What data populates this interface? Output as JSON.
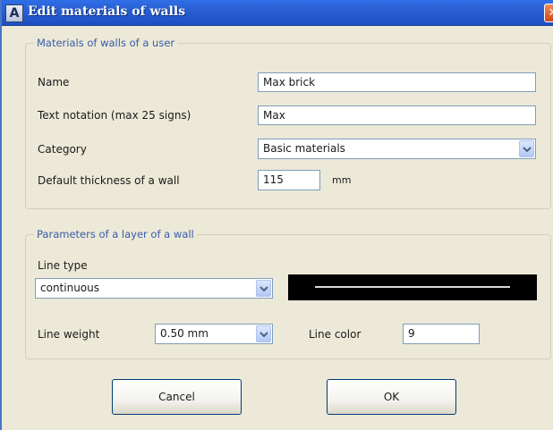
{
  "window": {
    "title": "Edit materials of walls",
    "app_icon": "A",
    "close_glyph": "✕"
  },
  "user_materials": {
    "caption": "Materials of walls of a user",
    "name_label": "Name",
    "name_value": "Max brick",
    "notation_label": "Text notation (max 25 signs)",
    "notation_value": "Max",
    "category_label": "Category",
    "category_value": "Basic materials",
    "thickness_label": "Default thickness of a wall",
    "thickness_value": "115",
    "thickness_unit": "mm"
  },
  "layer_params": {
    "caption": "Parameters of a layer of a wall",
    "line_type_label": "Line type",
    "line_type_value": "continuous",
    "line_weight_label": "Line weight",
    "line_weight_value": "0.50 mm",
    "line_color_label": "Line color",
    "line_color_value": "9"
  },
  "buttons": {
    "cancel": "Cancel",
    "ok": "OK"
  },
  "colors": {
    "titlebar": "#2a5fd2",
    "dialog_bg": "#ece9d8",
    "group_caption": "#3a5aa8",
    "input_border": "#7f9db9",
    "preview_bg": "#000000"
  },
  "icons": {
    "app": "app-logo-icon",
    "close": "close-icon",
    "dropdown": "chevron-down-icon"
  }
}
